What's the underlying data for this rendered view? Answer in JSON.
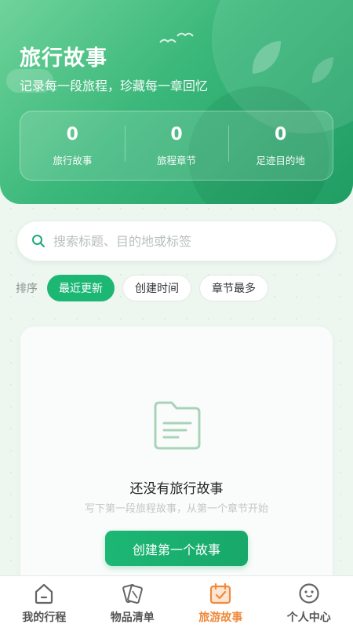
{
  "hero": {
    "title": "旅行故事",
    "subtitle": "记录每一段旅程，珍藏每一章回忆"
  },
  "stats": [
    {
      "value": "0",
      "label": "旅行故事"
    },
    {
      "value": "0",
      "label": "旅程章节"
    },
    {
      "value": "0",
      "label": "足迹目的地"
    }
  ],
  "search": {
    "value": "",
    "placeholder": "搜索标题、目的地或标签"
  },
  "sort": {
    "label": "排序",
    "options": [
      "最近更新",
      "创建时间",
      "章节最多"
    ],
    "selected": "最近更新"
  },
  "empty_state": {
    "icon": "document-icon",
    "title": "还没有旅行故事",
    "subtitle": "写下第一段旅程故事，从第一个章节开始",
    "button_label": "创建第一个故事"
  },
  "tabbar": {
    "items": [
      {
        "label": "我的行程",
        "icon": "home-icon"
      },
      {
        "label": "物品清单",
        "icon": "cards-icon"
      },
      {
        "label": "旅游故事",
        "icon": "calendar-check-icon"
      },
      {
        "label": "个人中心",
        "icon": "face-icon"
      }
    ],
    "active": "旅游故事"
  },
  "colors": {
    "primary": "#1db774",
    "hero_start": "#6fd39a",
    "hero_end": "#1f9d63",
    "active_tab": "#f08a3c"
  }
}
